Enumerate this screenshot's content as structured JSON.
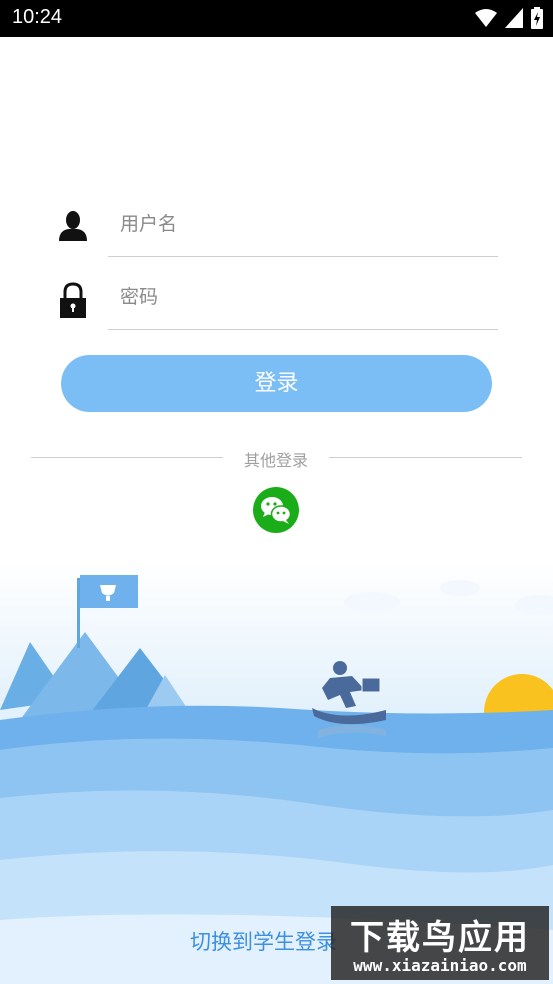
{
  "status_bar": {
    "time": "10:24",
    "icons": [
      "wifi-icon",
      "cellular-signal-icon",
      "battery-charging-icon"
    ]
  },
  "form": {
    "username_placeholder": "用户名",
    "password_placeholder": "密码",
    "login_label": "登录"
  },
  "other_login": {
    "label": "其他登录",
    "methods": [
      "wechat-icon"
    ]
  },
  "footer": {
    "switch_label": "切换到学生登录"
  },
  "watermark": {
    "title": "下载鸟应用",
    "url": "www.xiazainiao.com"
  },
  "colors": {
    "accent": "#7bbef5",
    "link": "#3d8fe0",
    "wechat": "#1aad19",
    "sun": "#f9c21f",
    "wave_light": "#a9d4f7",
    "wave_dark": "#6fb1ec"
  }
}
